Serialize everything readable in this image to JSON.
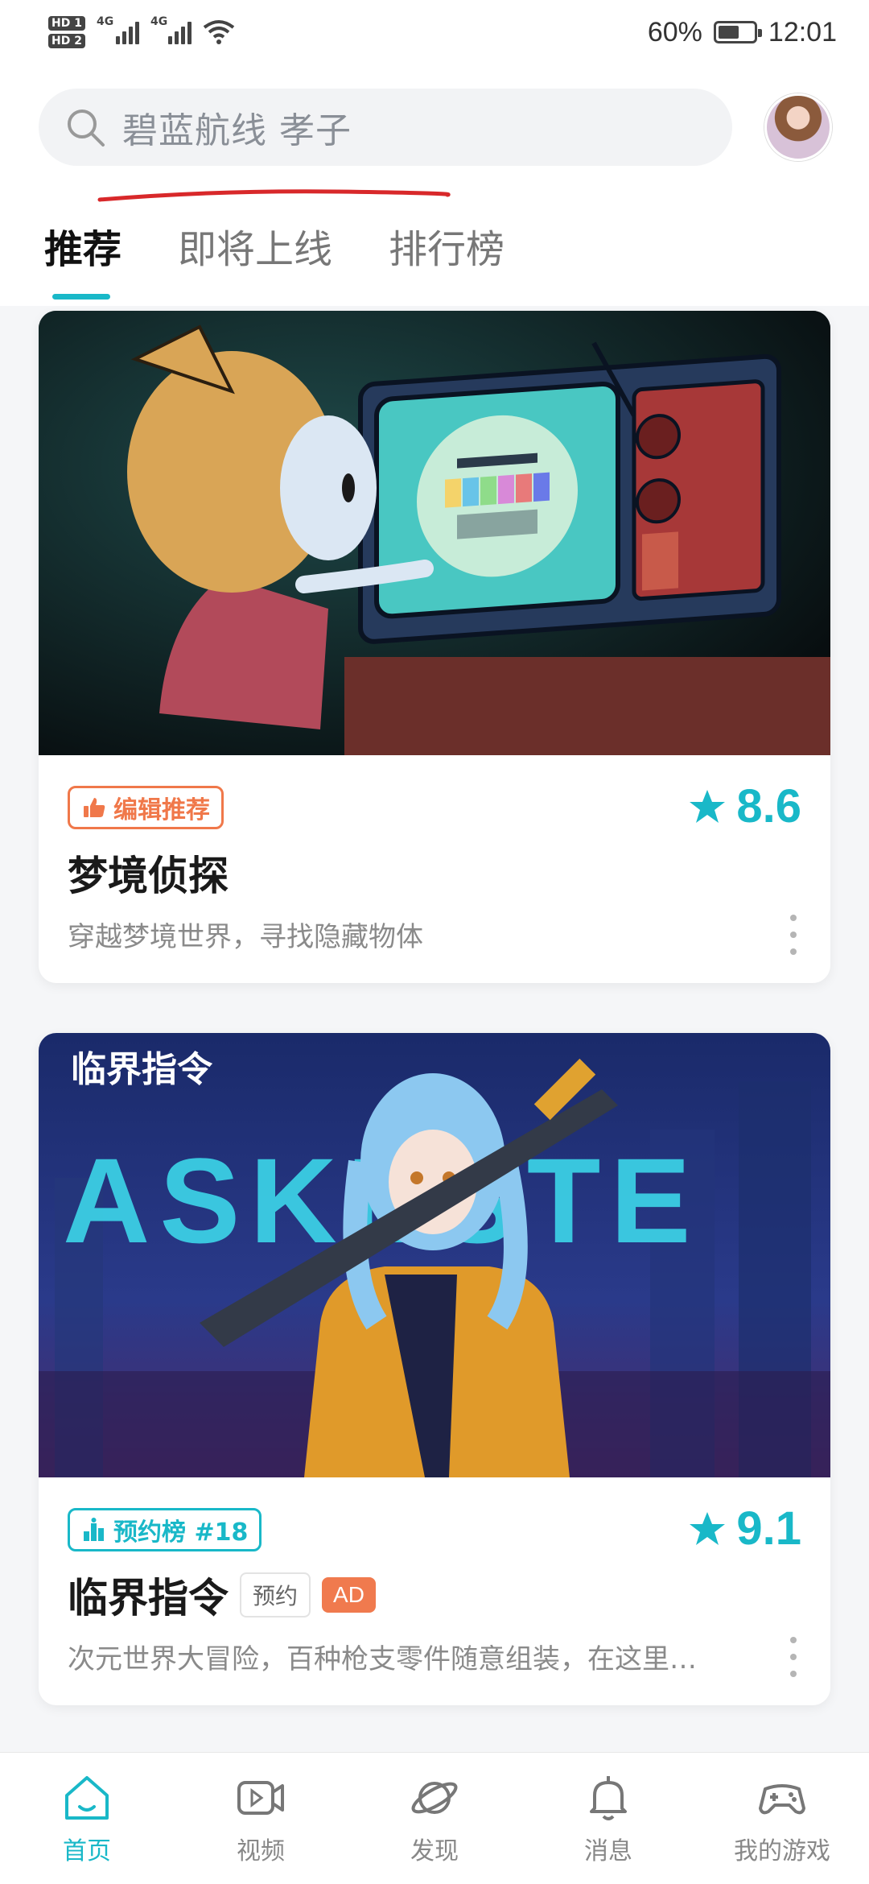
{
  "status_bar": {
    "hd1": "HD 1",
    "hd2": "HD 2",
    "sig1": "4G",
    "sig2": "4G",
    "battery_pct_label": "60%",
    "battery_level": 0.6,
    "time": "12:01"
  },
  "search": {
    "placeholder": "碧蓝航线 孝子"
  },
  "tabs": [
    {
      "label": "推荐",
      "active": true
    },
    {
      "label": "即将上线",
      "active": false
    },
    {
      "label": "排行榜",
      "active": false
    }
  ],
  "cards": [
    {
      "tag": "编辑推荐",
      "tag_icon": "thumbs-up-icon",
      "rating": "8.6",
      "title": "梦境侦探",
      "desc": "穿越梦境世界，寻找隐藏物体"
    },
    {
      "tag": "预约榜 #18",
      "tag_icon": "rank-bars-icon",
      "rating": "9.1",
      "title": "临界指令",
      "chip": "预约",
      "ad": "AD",
      "desc": "次元世界大冒险，百种枪支零件随意组装，在这里…",
      "banner_logo": "临界指令",
      "banner_text": "ASKESTE"
    }
  ],
  "nav": [
    {
      "label": "首页",
      "icon": "home-icon",
      "active": true
    },
    {
      "label": "视频",
      "icon": "video-icon",
      "active": false
    },
    {
      "label": "发现",
      "icon": "planet-icon",
      "active": false
    },
    {
      "label": "消息",
      "icon": "bell-icon",
      "active": false
    },
    {
      "label": "我的游戏",
      "icon": "gamepad-icon",
      "active": false
    }
  ],
  "colors": {
    "accent": "#19b8c8",
    "editor_tag": "#f0784a",
    "ad": "#f07a4e"
  }
}
